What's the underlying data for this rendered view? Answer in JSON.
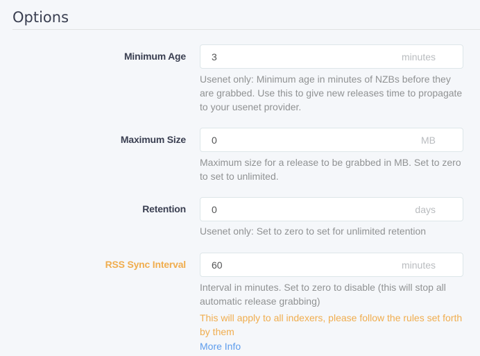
{
  "section": {
    "title": "Options"
  },
  "fields": [
    {
      "label": "Minimum Age",
      "value": "3",
      "unit": "minutes",
      "help": "Usenet only: Minimum age in minutes of NZBs before they are grabbed. Use this to give new releases time to propagate to your usenet provider."
    },
    {
      "label": "Maximum Size",
      "value": "0",
      "unit": "MB",
      "help": "Maximum size for a release to be grabbed in MB. Set to zero to set to unlimited."
    },
    {
      "label": "Retention",
      "value": "0",
      "unit": "days",
      "help": "Usenet only: Set to zero to set for unlimited retention"
    },
    {
      "label": "RSS Sync Interval",
      "value": "60",
      "unit": "minutes",
      "help": "Interval in minutes. Set to zero to disable (this will stop all automatic release grabbing)",
      "warning": "This will apply to all indexers, please follow the rules set forth by them",
      "link": "More Info"
    }
  ],
  "colors": {
    "warning": "#f0ad4e",
    "link": "#5d9cec",
    "help_text": "#909293",
    "label": "#3a3f51"
  }
}
